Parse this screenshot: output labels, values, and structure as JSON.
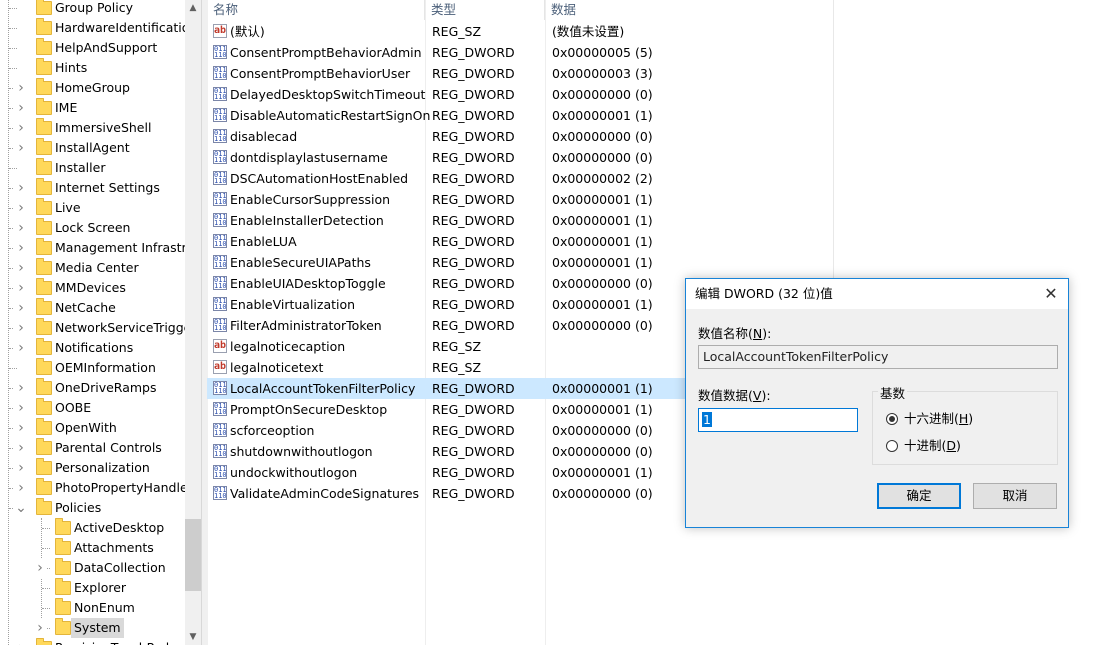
{
  "tree": {
    "items": [
      {
        "label": "Group Policy",
        "expander": ""
      },
      {
        "label": "HardwareIdentification",
        "expander": ""
      },
      {
        "label": "HelpAndSupport",
        "expander": ""
      },
      {
        "label": "Hints",
        "expander": ""
      },
      {
        "label": "HomeGroup",
        "expander": ">"
      },
      {
        "label": "IME",
        "expander": ">"
      },
      {
        "label": "ImmersiveShell",
        "expander": ">"
      },
      {
        "label": "InstallAgent",
        "expander": ">"
      },
      {
        "label": "Installer",
        "expander": ""
      },
      {
        "label": "Internet Settings",
        "expander": ">"
      },
      {
        "label": "Live",
        "expander": ">"
      },
      {
        "label": "Lock Screen",
        "expander": ">"
      },
      {
        "label": "Management Infrastructure",
        "expander": ">"
      },
      {
        "label": "Media Center",
        "expander": ">"
      },
      {
        "label": "MMDevices",
        "expander": ">"
      },
      {
        "label": "NetCache",
        "expander": ">"
      },
      {
        "label": "NetworkServiceTriggers",
        "expander": ">"
      },
      {
        "label": "Notifications",
        "expander": ">"
      },
      {
        "label": "OEMInformation",
        "expander": ""
      },
      {
        "label": "OneDriveRamps",
        "expander": ">"
      },
      {
        "label": "OOBE",
        "expander": ">"
      },
      {
        "label": "OpenWith",
        "expander": ">"
      },
      {
        "label": "Parental Controls",
        "expander": ">"
      },
      {
        "label": "Personalization",
        "expander": ">"
      },
      {
        "label": "PhotoPropertyHandler",
        "expander": ">"
      },
      {
        "label": "Policies",
        "expander": "v"
      },
      {
        "label": "ActiveDesktop",
        "expander": "",
        "child": true
      },
      {
        "label": "Attachments",
        "expander": "",
        "child": true
      },
      {
        "label": "DataCollection",
        "expander": ">",
        "child": true
      },
      {
        "label": "Explorer",
        "expander": "",
        "child": true
      },
      {
        "label": "NonEnum",
        "expander": "",
        "child": true
      },
      {
        "label": "System",
        "expander": ">",
        "child": true,
        "selected": true
      },
      {
        "label": "PrecisionTouchPad",
        "expander": ">"
      }
    ]
  },
  "list": {
    "headers": {
      "name": "名称",
      "type": "类型",
      "data": "数据"
    },
    "rows": [
      {
        "name": "(默认)",
        "type": "REG_SZ",
        "data": "(数值未设置)",
        "icon": "ab"
      },
      {
        "name": "ConsentPromptBehaviorAdmin",
        "type": "REG_DWORD",
        "data": "0x00000005 (5)",
        "icon": "dw"
      },
      {
        "name": "ConsentPromptBehaviorUser",
        "type": "REG_DWORD",
        "data": "0x00000003 (3)",
        "icon": "dw"
      },
      {
        "name": "DelayedDesktopSwitchTimeout",
        "type": "REG_DWORD",
        "data": "0x00000000 (0)",
        "icon": "dw"
      },
      {
        "name": "DisableAutomaticRestartSignOn",
        "type": "REG_DWORD",
        "data": "0x00000001 (1)",
        "icon": "dw"
      },
      {
        "name": "disablecad",
        "type": "REG_DWORD",
        "data": "0x00000000 (0)",
        "icon": "dw"
      },
      {
        "name": "dontdisplaylastusername",
        "type": "REG_DWORD",
        "data": "0x00000000 (0)",
        "icon": "dw"
      },
      {
        "name": "DSCAutomationHostEnabled",
        "type": "REG_DWORD",
        "data": "0x00000002 (2)",
        "icon": "dw"
      },
      {
        "name": "EnableCursorSuppression",
        "type": "REG_DWORD",
        "data": "0x00000001 (1)",
        "icon": "dw"
      },
      {
        "name": "EnableInstallerDetection",
        "type": "REG_DWORD",
        "data": "0x00000001 (1)",
        "icon": "dw"
      },
      {
        "name": "EnableLUA",
        "type": "REG_DWORD",
        "data": "0x00000001 (1)",
        "icon": "dw"
      },
      {
        "name": "EnableSecureUIAPaths",
        "type": "REG_DWORD",
        "data": "0x00000001 (1)",
        "icon": "dw"
      },
      {
        "name": "EnableUIADesktopToggle",
        "type": "REG_DWORD",
        "data": "0x00000000 (0)",
        "icon": "dw"
      },
      {
        "name": "EnableVirtualization",
        "type": "REG_DWORD",
        "data": "0x00000001 (1)",
        "icon": "dw"
      },
      {
        "name": "FilterAdministratorToken",
        "type": "REG_DWORD",
        "data": "0x00000000 (0)",
        "icon": "dw"
      },
      {
        "name": "legalnoticecaption",
        "type": "REG_SZ",
        "data": "",
        "icon": "ab"
      },
      {
        "name": "legalnoticetext",
        "type": "REG_SZ",
        "data": "",
        "icon": "ab"
      },
      {
        "name": "LocalAccountTokenFilterPolicy",
        "type": "REG_DWORD",
        "data": "0x00000001 (1)",
        "icon": "dw",
        "selected": true
      },
      {
        "name": "PromptOnSecureDesktop",
        "type": "REG_DWORD",
        "data": "0x00000001 (1)",
        "icon": "dw"
      },
      {
        "name": "scforceoption",
        "type": "REG_DWORD",
        "data": "0x00000000 (0)",
        "icon": "dw"
      },
      {
        "name": "shutdownwithoutlogon",
        "type": "REG_DWORD",
        "data": "0x00000000 (0)",
        "icon": "dw"
      },
      {
        "name": "undockwithoutlogon",
        "type": "REG_DWORD",
        "data": "0x00000001 (1)",
        "icon": "dw"
      },
      {
        "name": "ValidateAdminCodeSignatures",
        "type": "REG_DWORD",
        "data": "0x00000000 (0)",
        "icon": "dw"
      }
    ]
  },
  "dialog": {
    "title": "编辑 DWORD (32 位)值",
    "value_name_label_pre": "数值名称(",
    "value_name_label_key": "N",
    "value_name_label_post": "):",
    "value_name": "LocalAccountTokenFilterPolicy",
    "value_data_label_pre": "数值数据(",
    "value_data_label_key": "V",
    "value_data_label_post": "):",
    "value_data": "1",
    "base_label": "基数",
    "hex_label_pre": "十六进制(",
    "hex_label_key": "H",
    "hex_label_post": ")",
    "dec_label_pre": "十进制(",
    "dec_label_key": "D",
    "dec_label_post": ")",
    "hex_selected": true,
    "ok_label": "确定",
    "cancel_label": "取消"
  },
  "colors": {
    "selection": "#cce8ff",
    "accent": "#0078d7",
    "folder": "#ffd85a"
  }
}
